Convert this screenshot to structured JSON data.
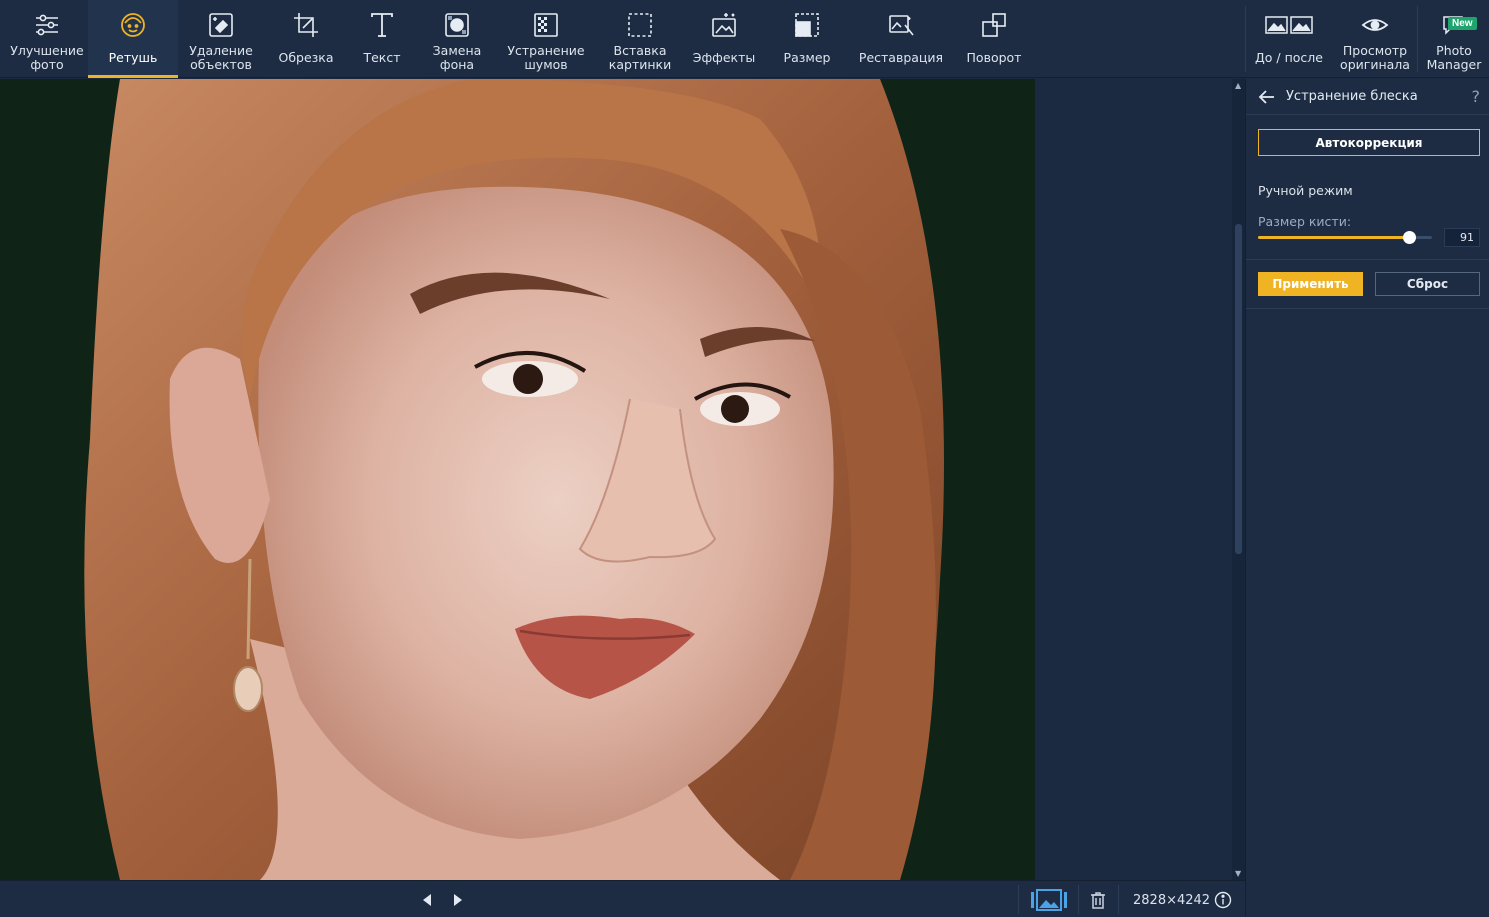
{
  "toolbar": {
    "tools": [
      {
        "label": "Улучшение\nфото",
        "icon": "sliders-icon"
      },
      {
        "label": "Ретушь",
        "icon": "face-icon"
      },
      {
        "label": "Удаление\nобъектов",
        "icon": "eraser-icon"
      },
      {
        "label": "Обрезка",
        "icon": "crop-icon"
      },
      {
        "label": "Текст",
        "icon": "text-icon"
      },
      {
        "label": "Замена\nфона",
        "icon": "background-replace-icon"
      },
      {
        "label": "Устранение\nшумов",
        "icon": "denoise-icon"
      },
      {
        "label": "Вставка\nкартинки",
        "icon": "insert-image-icon"
      },
      {
        "label": "Эффекты",
        "icon": "effects-icon"
      },
      {
        "label": "Размер",
        "icon": "resize-icon"
      },
      {
        "label": "Реставрация",
        "icon": "restoration-icon"
      },
      {
        "label": "Поворот",
        "icon": "rotate-icon"
      }
    ],
    "right": {
      "before_after": "До / после",
      "view_original": "Просмотр\nоригинала",
      "photo_manager": "Photo\nManager",
      "new_badge": "New"
    },
    "accent": "#f0b323"
  },
  "panel": {
    "title": "Устранение блеска",
    "help": "?",
    "auto_button": "Автокоррекция",
    "manual_mode": "Ручной режим",
    "brush_size_label": "Размер кисти:",
    "brush_size_value": "91",
    "brush_size_fraction": 0.87,
    "apply_button": "Применить",
    "reset_button": "Сброс"
  },
  "statusbar": {
    "image_size": "2828×4242"
  }
}
